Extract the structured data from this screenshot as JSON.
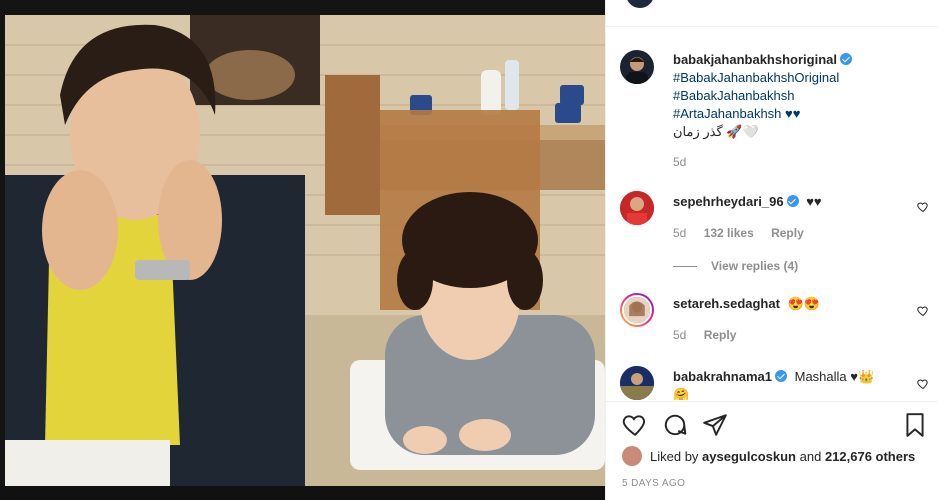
{
  "post": {
    "author": "babakjahanbakhshoriginal",
    "caption_tags": [
      "#BabakJahanbakhshOriginal",
      "#BabakJahanbakhsh",
      "#ArtaJahanbakhsh ♥♥"
    ],
    "caption_extra": "گذر زمان 🚀🤍",
    "age": "5d"
  },
  "comments": [
    {
      "user": "sepehrheydari_96",
      "verified": true,
      "text": "♥♥",
      "age": "5d",
      "likes": "132 likes",
      "reply": "Reply",
      "view_replies": "View replies (4)"
    },
    {
      "user": "setareh.sedaghat",
      "verified": false,
      "text": "😍😍",
      "age": "5d",
      "reply": "Reply"
    },
    {
      "user": "babakrahnama1",
      "verified": true,
      "text": "Mashalla ♥👑",
      "extra": "🤗"
    }
  ],
  "footer": {
    "liked_prefix": "Liked by",
    "liked_user": "aysegulcoskun",
    "liked_and": "and",
    "liked_count": "212,676 others",
    "date": "5 DAYS AGO"
  },
  "icons": [
    "heart-icon",
    "comment-icon",
    "share-icon",
    "bookmark-icon"
  ],
  "colors": {
    "link": "#00376b",
    "verified": "#3897f0",
    "muted": "#8e8e8e"
  }
}
